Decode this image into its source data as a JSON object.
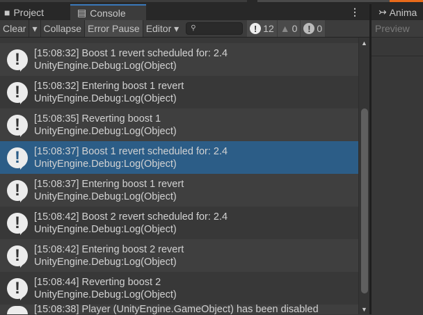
{
  "tabs": {
    "project": "Project",
    "console": "Console",
    "animation": "Anima"
  },
  "toolbar": {
    "clear": "Clear",
    "collapse": "Collapse",
    "error_pause": "Error Pause",
    "editor": "Editor",
    "search_placeholder": "",
    "log_count": "12",
    "warning_count": "0",
    "error_count": "0"
  },
  "right_panel": {
    "preview": "Preview"
  },
  "logs": [
    {
      "message": "[15:08:32] Boost 1 revert scheduled for: 2.4",
      "trace": "UnityEngine.Debug:Log(Object)"
    },
    {
      "message": "[15:08:32] Entering boost 1 revert",
      "trace": "UnityEngine.Debug:Log(Object)"
    },
    {
      "message": "[15:08:35] Reverting boost 1",
      "trace": "UnityEngine.Debug:Log(Object)"
    },
    {
      "message": "[15:08:37] Boost 1 revert scheduled for: 2.4",
      "trace": "UnityEngine.Debug:Log(Object)",
      "selected": true
    },
    {
      "message": "[15:08:37] Entering boost 1 revert",
      "trace": "UnityEngine.Debug:Log(Object)"
    },
    {
      "message": "[15:08:42] Boost 2 revert scheduled for: 2.4",
      "trace": "UnityEngine.Debug:Log(Object)"
    },
    {
      "message": "[15:08:42] Entering boost 2 revert",
      "trace": "UnityEngine.Debug:Log(Object)"
    },
    {
      "message": "[15:08:44] Reverting boost 2",
      "trace": "UnityEngine.Debug:Log(Object)"
    },
    {
      "message": "[15:08:38] Player (UnityEngine.GameObject) has been disabled",
      "trace": ""
    }
  ]
}
